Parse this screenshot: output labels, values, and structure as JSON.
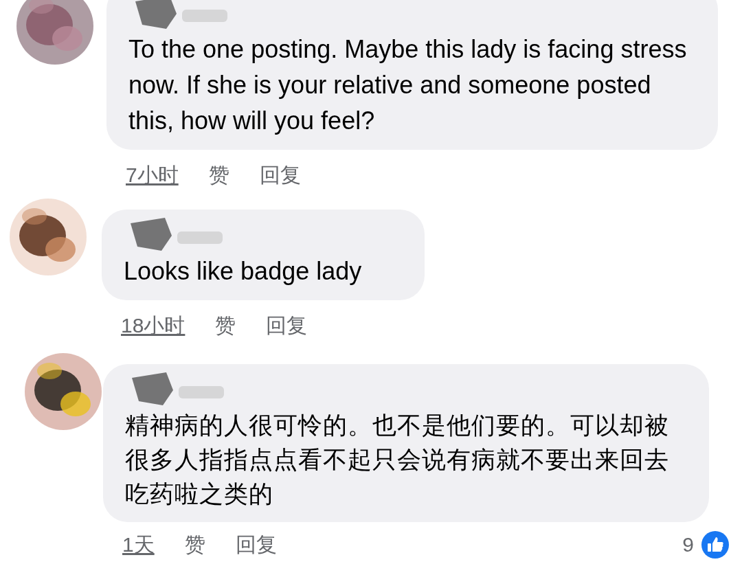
{
  "comments": [
    {
      "text": "To the one posting. Maybe this lady is facing stress now. If she is your relative and someone posted this, how will you feel?",
      "time": "7小时",
      "actions": [
        "赞",
        "回复"
      ]
    },
    {
      "text": "Looks like badge lady",
      "time": "18小时",
      "actions": [
        "赞",
        "回复"
      ]
    },
    {
      "text": "精神病的人很可怜的。也不是他们要的。可以却被很多人指指点点看不起只会说有病就不要出来回去吃药啦之类的",
      "time": "1天",
      "actions": [
        "赞",
        "回复"
      ],
      "reactions": "9"
    }
  ]
}
